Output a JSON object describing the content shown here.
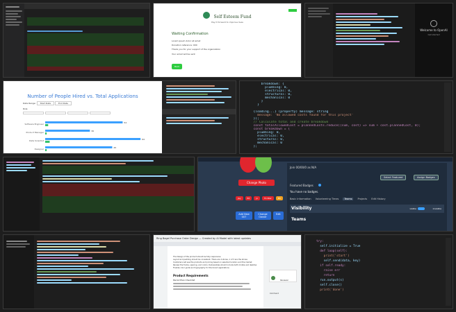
{
  "t2": {
    "logo_text": "Self Esteem Fund",
    "tagline": "Pay it forward to improve lives",
    "heading": "Waiting Confirmation",
    "lines": [
      "Lorem ipsum dolor sit amet",
      "Donation reference: 000",
      "Thank you for your support of the organization",
      "Your email will be sent"
    ],
    "button": "Back"
  },
  "t3": {
    "welcome": "Welcome to OpenAI",
    "sub": "Get started"
  },
  "t4": {
    "title": "Number of People Hired vs. Total Applications",
    "date_range_label": "Date Range:",
    "date_from": "Start Date",
    "date_to": "End Date",
    "filter_label": "Role",
    "bars": [
      {
        "label": "Software Engineer",
        "hired": 2,
        "total": 52
      },
      {
        "label": "Product Manager",
        "hired": 1,
        "total": 30
      },
      {
        "label": "Data Scientist",
        "hired": 3,
        "total": 64
      },
      {
        "label": "Designer",
        "hired": 1,
        "total": 45
      }
    ]
  },
  "t5": {
    "code_lines": [
      "      breakdown: {",
      "        plumbing: 0,",
      "        electrical: 0,",
      "        structural: 0,",
      "        mechanical: 0",
      "      }",
      "    }",
      "  ",
      "  {loading...} (property) message: string",
      "    message: 'No allowed costs found for this project'",
      "  });",
      "",
      "  // Calculate total and create breakdown",
      "  const totalAllowedCost = plannedCosts.reduce((sum, cost) => sum + cost.plannedCost, 0);",
      "",
      "  const breakdown = {",
      "    plumbing: 0,",
      "    electrical: 0,",
      "    structural: 0,",
      "    mechanical: 0",
      "  };"
    ]
  },
  "t6": {
    "header_text": "Join 00/00/0 as N/A",
    "change_photo": "Change Photo",
    "featured_badges": "Featured Badges",
    "select_featured": "Select Featured",
    "assign_badges": "Assign Badges",
    "no_badges": "You have no badges.",
    "tabs": [
      "Basic Information",
      "Volunteering Times",
      "Teams",
      "Projects",
      "Edit History"
    ],
    "active_tab": "Teams",
    "visibility": "Visibility",
    "visible": "visible",
    "invisible": "invisible",
    "teams": "Teams",
    "side_buttons": [
      "Add New 007",
      "Change Owner",
      "Edit"
    ],
    "chips": [
      "Jay",
      "Ed",
      "Jo",
      "Tri-Star",
      "Pin"
    ]
  },
  "t8": {
    "title": "Ring Bagel Purchase Order Design — Created by AI Model with latest updates",
    "section": "Product Requirements",
    "bullets": [
      "The Design of the product should be fully responsive",
      "Layout and padding should be consistent. There are 4 stores, 1 of 3 are the stores",
      "Customers will see the products and pricing based on selected location and the market",
      "Review the frame, spacing, and colors. Deliverables should include both mobile and desktop",
      "Finalize color guide and typography for the brand applications"
    ],
    "sub_heading": "Period Plan Checklist",
    "comment_name": "Reviewer Comment"
  },
  "t9": {
    "code_lines": [
      "try:",
      "  self.initialize = True",
      "  def loop(self):",
      "    print('start')",
      "    self.send(data, key)",
      "",
      "  if self.ready:",
      "    raise err",
      "    return",
      "",
      "  run.output(s)",
      "  self.close()",
      "  print('done')"
    ]
  },
  "colors": {
    "editor_bg": "#1e1e1e",
    "keyword": "#c586c0",
    "string": "#ce9178",
    "variable": "#9cdcfe",
    "comment": "#6a9955",
    "accent": "#007acc",
    "diff_red": "#5a1d1d",
    "diff_green": "#1f3d1f",
    "chart_bar": "#3aa0ff",
    "chart_hired": "#34c36b",
    "red_button": "#e0262e",
    "blue_panel": "#2a3a4f"
  }
}
